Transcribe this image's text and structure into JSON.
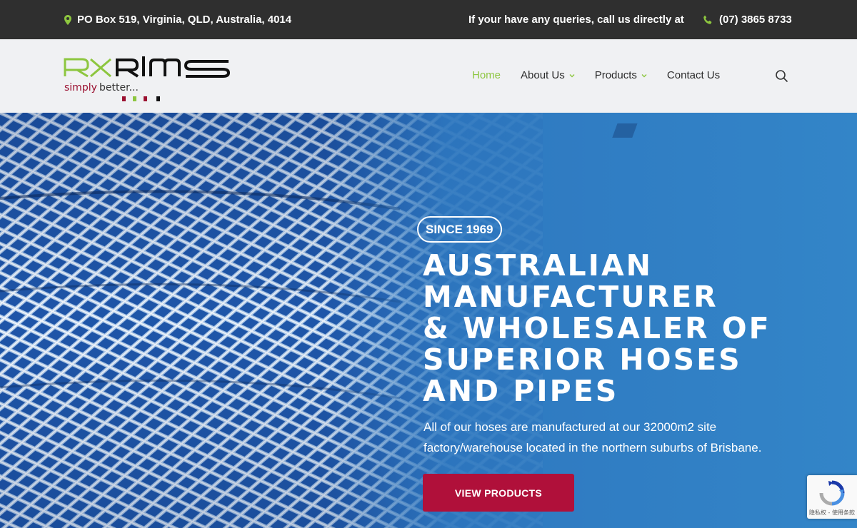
{
  "topbar": {
    "address": "PO Box 519, Virginia, QLD, Australia, 4014",
    "query_text": "If your have any queries, call us directly at",
    "phone": "(07) 3865 8733",
    "location_icon": "map-marker-icon",
    "phone_icon": "phone-icon"
  },
  "logo": {
    "wordmark": "RXRims",
    "tagline_simply": "simply",
    "tagline_better": "better..."
  },
  "nav": {
    "items": [
      {
        "label": "Home",
        "active": true,
        "dropdown": false
      },
      {
        "label": "About Us",
        "active": false,
        "dropdown": true
      },
      {
        "label": "Products",
        "active": false,
        "dropdown": true
      },
      {
        "label": "Contact Us",
        "active": false,
        "dropdown": false
      }
    ],
    "search_icon": "search-icon"
  },
  "hero": {
    "badge": "SINCE 1969",
    "headline_lines": [
      "AUSTRALIAN",
      "MANUFACTURER",
      "& WHOLESALER OF",
      "SUPERIOR HOSES",
      "AND PIPES"
    ],
    "description": "All of our hoses are manufactured at our 32000m2 site factory/warehouse located in the northern suburbs of Brisbane.",
    "cta_label": "VIEW PRODUCTS"
  },
  "recaptcha": {
    "text": "隐私权 - 使用条款"
  },
  "colors": {
    "accent_green": "#8dc63f",
    "cta_red": "#b0103a",
    "topbar_bg": "#2f2f2f",
    "header_bg": "#f0f1f3",
    "hero_blue": "#2e74bd"
  }
}
